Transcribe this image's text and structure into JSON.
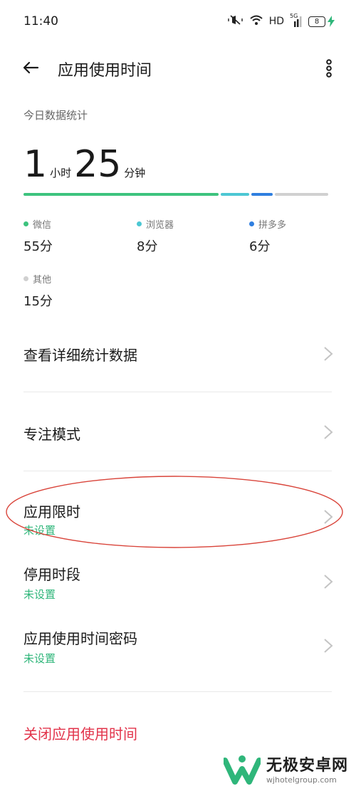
{
  "status_bar": {
    "time": "11:40",
    "network": "HD",
    "network_gen": "5G",
    "battery": "8"
  },
  "header": {
    "title": "应用使用时间"
  },
  "stats": {
    "label": "今日数据统计",
    "hours": "1",
    "hours_unit": "小时",
    "minutes": "25",
    "minutes_unit": "分钟",
    "apps": [
      {
        "name": "微信",
        "value": "55分",
        "color": "#3dc37e",
        "share": 0.647
      },
      {
        "name": "浏览器",
        "value": "8分",
        "color": "#4cc7d3",
        "share": 0.094
      },
      {
        "name": "拼多多",
        "value": "6分",
        "color": "#2f7fe0",
        "share": 0.071
      },
      {
        "name": "其他",
        "value": "15分",
        "color": "#d0d0d0",
        "share": 0.176
      }
    ]
  },
  "menu": {
    "detail_stats": "查看详细统计数据",
    "focus_mode": "专注模式",
    "app_limit": {
      "title": "应用限时",
      "status": "未设置"
    },
    "downtime": {
      "title": "停用时段",
      "status": "未设置"
    },
    "password": {
      "title": "应用使用时间密码",
      "status": "未设置"
    },
    "close": "关闭应用使用时间"
  },
  "colors": {
    "accent_green": "#2fb67a",
    "danger_red": "#e2334a",
    "annotation": "#d9443a"
  },
  "watermark": {
    "name": "无极安卓网",
    "url": "wjhotelgroup.com"
  }
}
